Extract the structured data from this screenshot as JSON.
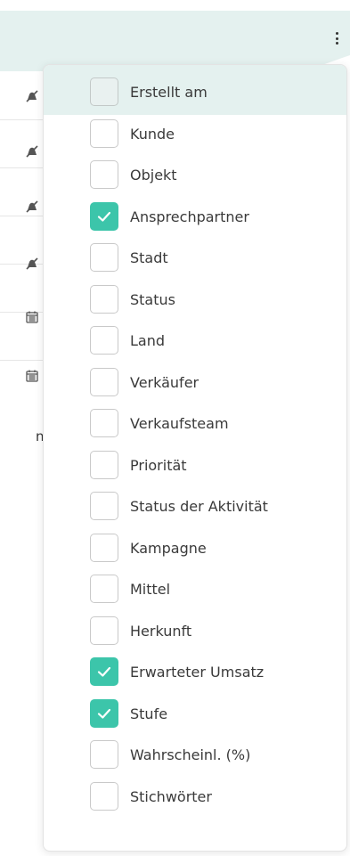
{
  "background": {
    "truncated_text": "n.",
    "row_icons": [
      "bell-off-icon",
      "bell-off-icon",
      "bell-off-icon",
      "bell-off-icon",
      "calendar-icon",
      "calendar-icon"
    ]
  },
  "dropdown": {
    "accent_color": "#3cc5aa",
    "options": [
      {
        "label": "Erstellt am",
        "checked": false
      },
      {
        "label": "Kunde",
        "checked": false
      },
      {
        "label": "Objekt",
        "checked": false
      },
      {
        "label": "Ansprechpartner",
        "checked": true
      },
      {
        "label": "Stadt",
        "checked": false
      },
      {
        "label": "Status",
        "checked": false
      },
      {
        "label": "Land",
        "checked": false
      },
      {
        "label": "Verkäufer",
        "checked": false
      },
      {
        "label": "Verkaufsteam",
        "checked": false
      },
      {
        "label": "Priorität",
        "checked": false
      },
      {
        "label": "Status der Aktivität",
        "checked": false
      },
      {
        "label": "Kampagne",
        "checked": false
      },
      {
        "label": "Mittel",
        "checked": false
      },
      {
        "label": "Herkunft",
        "checked": false
      },
      {
        "label": "Erwarteter Umsatz",
        "checked": true
      },
      {
        "label": "Stufe",
        "checked": true
      },
      {
        "label": "Wahrscheinl. (%)",
        "checked": false
      },
      {
        "label": "Stichwörter",
        "checked": false
      }
    ]
  }
}
